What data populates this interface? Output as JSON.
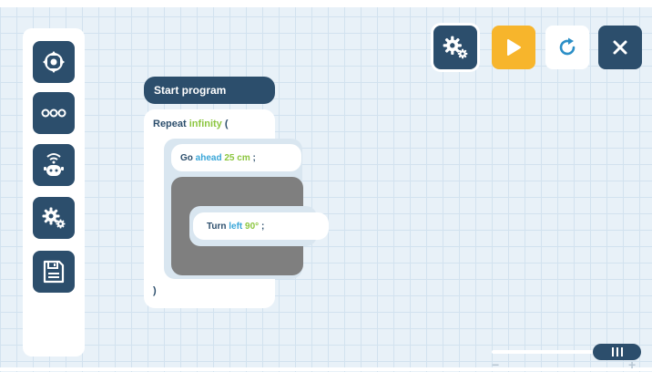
{
  "sidebar": {
    "buttons": [
      {
        "icon": "dpad-icon"
      },
      {
        "icon": "ellipsis-icon"
      },
      {
        "icon": "robot-icon"
      },
      {
        "icon": "gears-icon"
      },
      {
        "icon": "save-icon"
      }
    ]
  },
  "toolbar": {
    "settings_icon": "gears-icon",
    "play_icon": "play-icon",
    "reset_icon": "reset-icon",
    "close_icon": "close-icon"
  },
  "program": {
    "start_label": "Start program",
    "repeat_keyword": "Repeat",
    "repeat_value": "infinity",
    "repeat_open": "(",
    "go_keyword": "Go",
    "go_direction": "ahead",
    "go_distance": "25 cm",
    "go_end": ";",
    "turn_keyword": "Turn",
    "turn_direction": "left",
    "turn_angle": "90°",
    "turn_end": ";",
    "repeat_close": ")"
  },
  "zoom": {
    "minus_label": "−",
    "plus_label": "+"
  },
  "colors": {
    "primary": "#2c4e6c",
    "accent_play": "#f7b52c",
    "keyword_green": "#8cc63f",
    "keyword_blue": "#3aa6d8"
  }
}
